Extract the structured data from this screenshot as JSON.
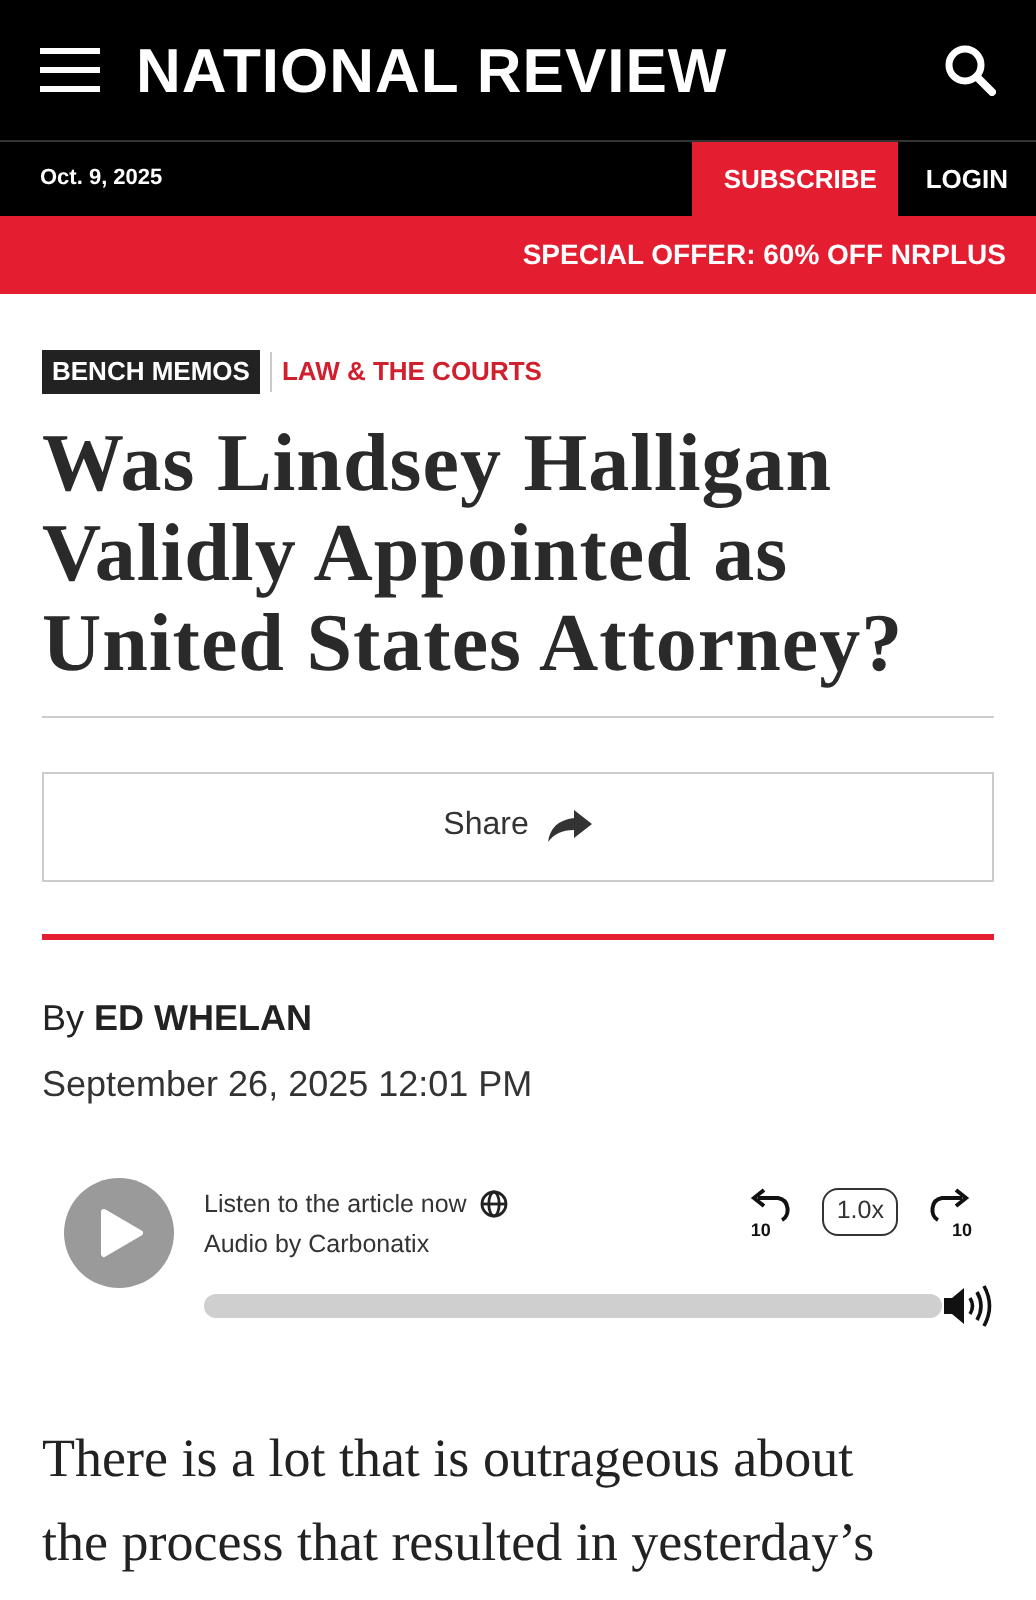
{
  "header": {
    "logo": "NATIONAL REVIEW"
  },
  "top_bar": {
    "date": "Oct. 9, 2025",
    "subscribe": "SUBSCRIBE",
    "login": "LOGIN"
  },
  "offer_banner": "SPECIAL OFFER: 60% OFF NRPLUS",
  "tags": [
    {
      "label": "BENCH MEMOS",
      "kind": "badge"
    },
    {
      "label": "LAW & THE COURTS",
      "kind": "link"
    }
  ],
  "headline": "Was Lindsey Halligan Validly Appointed as United States Attorney?",
  "share_button": "Share",
  "byline": {
    "prefix": "By",
    "author": "ED WHELAN"
  },
  "date": "September 26, 2025 12:01 PM",
  "audio_player": {
    "title": "Listen to the article now",
    "credit": "Audio by Carbonatix",
    "skip_back": "10",
    "speed": "1.0x",
    "skip_forward": "10"
  },
  "body_lines": [
    "There is a lot that is outrageous about",
    "the process that resulted in yesterday’s"
  ]
}
